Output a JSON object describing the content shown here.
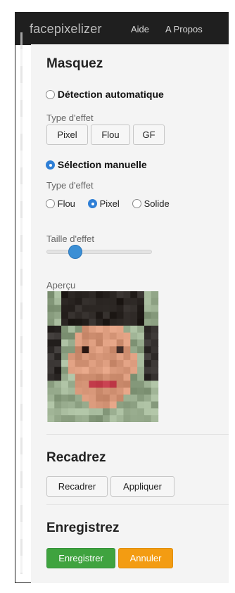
{
  "header": {
    "brand": "facepixelizer",
    "nav": [
      "Aide",
      "A Propos"
    ]
  },
  "mask_section": {
    "title": "Masquez",
    "auto_detection": {
      "label": "Détection automatique",
      "selected": false,
      "effect_label": "Type d'effet",
      "buttons": [
        "Pixel",
        "Flou",
        "GF"
      ]
    },
    "manual_selection": {
      "label": "Sélection manuelle",
      "selected": true,
      "effect_label": "Type d'effet",
      "options": [
        {
          "label": "Flou",
          "selected": false
        },
        {
          "label": "Pixel",
          "selected": true
        },
        {
          "label": "Solide",
          "selected": false
        }
      ]
    },
    "effect_size": {
      "label": "Taille d'effet",
      "value_fraction": 0.25
    },
    "preview_label": "Aperçu"
  },
  "crop_section": {
    "title": "Recadrez",
    "buttons": [
      "Recadrer",
      "Appliquer"
    ]
  },
  "save_section": {
    "title": "Enregistrez",
    "save_button": "Enregistrer",
    "cancel_button": "Annuler"
  },
  "colors": {
    "header_bg": "#1f1f1f",
    "accent_blue": "#2f7fd6",
    "save_green": "#3fa33f",
    "cancel_orange": "#f39c12"
  }
}
